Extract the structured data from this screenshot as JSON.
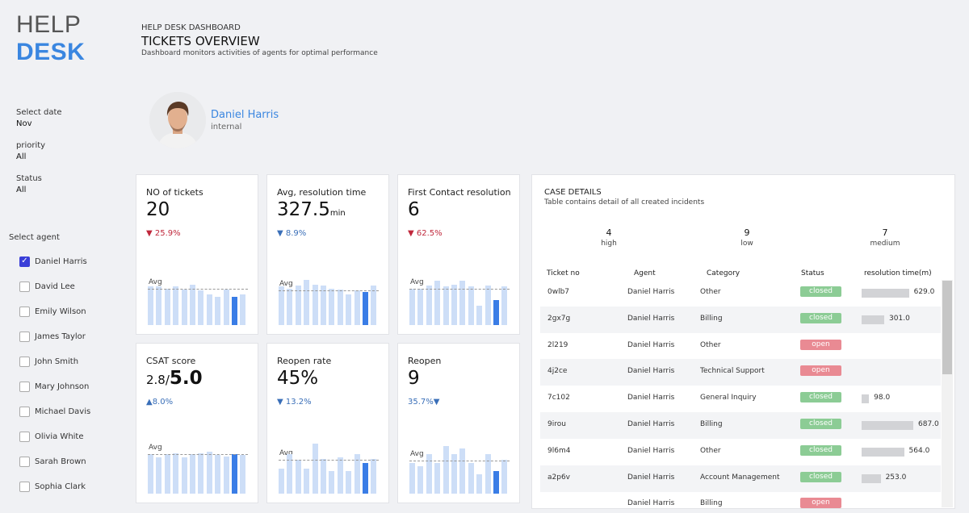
{
  "logo": {
    "line1": "HELP",
    "line2": "DESK"
  },
  "header": {
    "small": "HELP DESK DASHBOARD",
    "title": "TICKETS OVERVIEW",
    "subtitle": "Dashboard monitors activities of agents for optimal performance"
  },
  "filters": {
    "date_label": "Select date",
    "date_value": "Nov",
    "priority_label": "priority",
    "priority_value": "All",
    "status_label": "Status",
    "status_value": "All",
    "agent_label": "Select agent"
  },
  "agents": [
    {
      "name": "Daniel Harris",
      "checked": true
    },
    {
      "name": "David Lee",
      "checked": false
    },
    {
      "name": "Emily Wilson",
      "checked": false
    },
    {
      "name": "James Taylor",
      "checked": false
    },
    {
      "name": "John Smith",
      "checked": false
    },
    {
      "name": "Mary Johnson",
      "checked": false
    },
    {
      "name": "Michael Davis",
      "checked": false
    },
    {
      "name": "Olivia White",
      "checked": false
    },
    {
      "name": "Sarah Brown",
      "checked": false
    },
    {
      "name": "Sophia Clark",
      "checked": false
    }
  ],
  "profile": {
    "name": "Daniel Harris",
    "type": "internal"
  },
  "kpis": [
    {
      "title": "NO of tickets",
      "value": "20",
      "unit": "",
      "delta": "▼ 25.9%",
      "delta_color": "red",
      "avg_label": "Avg",
      "avg": 0.65,
      "bars": [
        0.68,
        0.68,
        0.65,
        0.68,
        0.63,
        0.72,
        0.62,
        0.55,
        0.5,
        0.63,
        0.5,
        0.55
      ],
      "highlight": 10
    },
    {
      "title": "Avg, resolution time",
      "value": "327.5",
      "unit": "min",
      "delta": "▼ 8.9%",
      "delta_color": "blue",
      "avg_label": "Avg",
      "avg": 0.62,
      "bars": [
        0.68,
        0.65,
        0.7,
        0.8,
        0.72,
        0.7,
        0.65,
        0.63,
        0.55,
        0.62,
        0.58,
        0.7
      ],
      "highlight": 10
    },
    {
      "title": "First Contact resolution",
      "value": "6",
      "unit": "",
      "delta": "▼ 62.5%",
      "delta_color": "red",
      "avg_label": "Avg",
      "avg": 0.65,
      "bars": [
        0.65,
        0.65,
        0.7,
        0.78,
        0.68,
        0.72,
        0.78,
        0.68,
        0.35,
        0.7,
        0.45,
        0.68
      ],
      "highlight": 10
    },
    {
      "title": "CSAT score",
      "value": "5.0",
      "prefix": "2.8/",
      "unit": "",
      "delta": "▲8.0%",
      "delta_color": "blue",
      "avg_label": "Avg",
      "avg": 0.7,
      "bars": [
        0.7,
        0.65,
        0.7,
        0.72,
        0.65,
        0.7,
        0.72,
        0.74,
        0.68,
        0.66,
        0.7,
        0.68
      ],
      "highlight": 10
    },
    {
      "title": "Reopen rate",
      "value": "45%",
      "unit": "",
      "delta": "▼ 13.2%",
      "delta_color": "blue",
      "avg_label": "Avg",
      "avg": 0.6,
      "bars": [
        0.45,
        0.7,
        0.6,
        0.45,
        0.88,
        0.62,
        0.4,
        0.65,
        0.4,
        0.7,
        0.55,
        0.62
      ],
      "highlight": 10
    },
    {
      "title": "Reopen",
      "value": "9",
      "unit": "",
      "delta": "35.7%▼",
      "delta_color": "blue",
      "avg_label": "Avg",
      "avg": 0.58,
      "bars": [
        0.55,
        0.48,
        0.7,
        0.55,
        0.85,
        0.7,
        0.8,
        0.55,
        0.35,
        0.7,
        0.4,
        0.6
      ],
      "highlight": 10
    }
  ],
  "case": {
    "title": "CASE DETAILS",
    "subtitle": "Table contains detail of all created incidents",
    "stats": [
      {
        "n": "4",
        "l": "high"
      },
      {
        "n": "9",
        "l": "low"
      },
      {
        "n": "7",
        "l": "medium"
      }
    ],
    "columns": [
      "Ticket no",
      "Agent",
      "Category",
      "Status",
      "resolution time(m)"
    ],
    "rows": [
      {
        "ticket": "0wlb7",
        "agent": "Daniel Harris",
        "category": "Other",
        "status": "closed",
        "time": "629.0",
        "tval": 629
      },
      {
        "ticket": "2gx7g",
        "agent": "Daniel Harris",
        "category": "Billing",
        "status": "closed",
        "time": "301.0",
        "tval": 301
      },
      {
        "ticket": "2l219",
        "agent": "Daniel Harris",
        "category": "Other",
        "status": "open",
        "time": "",
        "tval": 0
      },
      {
        "ticket": "4j2ce",
        "agent": "Daniel Harris",
        "category": "Technical Support",
        "status": "open",
        "time": "",
        "tval": 0
      },
      {
        "ticket": "7c102",
        "agent": "Daniel Harris",
        "category": "General Inquiry",
        "status": "closed",
        "time": "98.0",
        "tval": 98
      },
      {
        "ticket": "9irou",
        "agent": "Daniel Harris",
        "category": "Billing",
        "status": "closed",
        "time": "687.0",
        "tval": 687
      },
      {
        "ticket": "9l6m4",
        "agent": "Daniel Harris",
        "category": "Other",
        "status": "closed",
        "time": "564.0",
        "tval": 564
      },
      {
        "ticket": "a2p6v",
        "agent": "Daniel Harris",
        "category": "Account Management",
        "status": "closed",
        "time": "253.0",
        "tval": 253
      },
      {
        "ticket": "",
        "agent": "Daniel Harris",
        "category": "Billing",
        "status": "open",
        "time": "",
        "tval": 0
      }
    ]
  }
}
